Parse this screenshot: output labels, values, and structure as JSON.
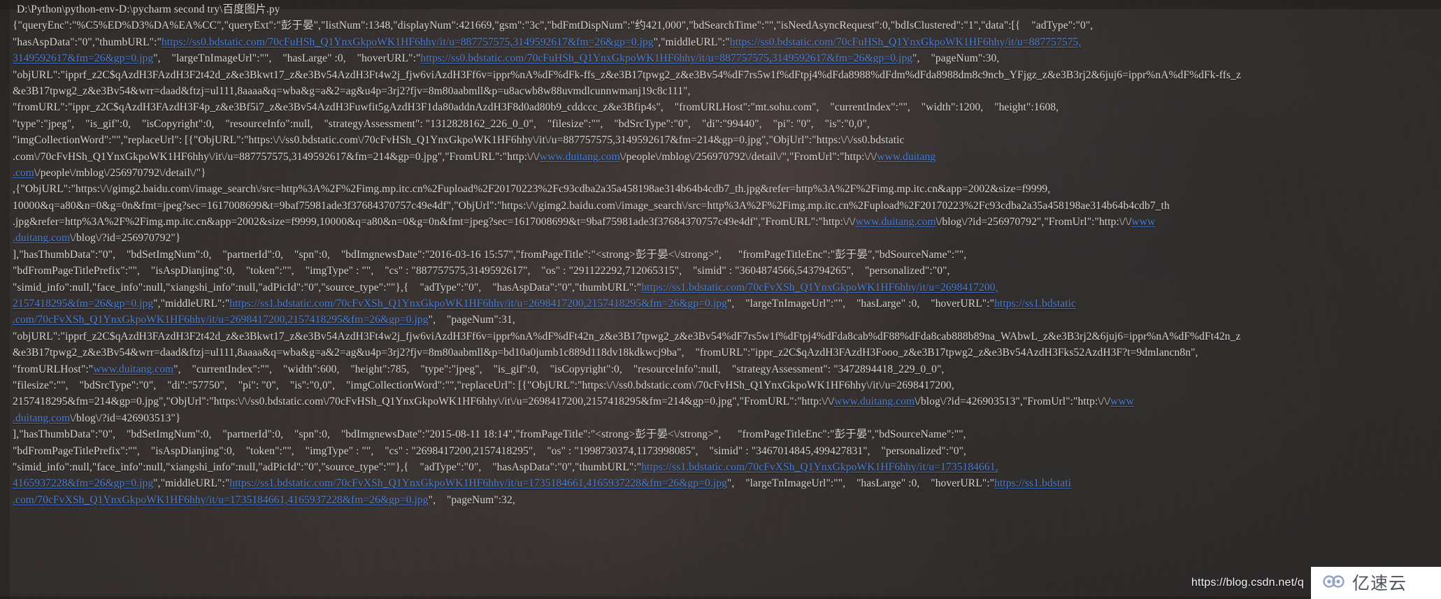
{
  "window": {
    "kind": "ide-run-console",
    "overlay_color": "#2a2828",
    "text_color": "#d8d5d0",
    "link_color": "#4b7fd4"
  },
  "console": {
    "lines": [
      {
        "indent": "first",
        "segments": [
          {
            "t": "D:\\Python\\python-env-D:\\pycharm second try\\百度图片.py",
            "link": false
          }
        ]
      },
      {
        "indent": "normal",
        "segments": [
          {
            "t": "{\"queryEnc\":\"%C5%ED%D3%DA%EA%CC\",\"queryExt\":\"彭于晏\",\"listNum\":1348,\"displayNum\":421669,\"gsm\":\"3c\",\"bdFmtDispNum\":\"约421,000\",\"bdSearchTime\":\"\",\"isNeedAsyncRequest\":0,\"bdIsClustered\":\"1\",\"data\":[{    \"adType\":\"0\",",
            "link": false
          }
        ]
      },
      {
        "indent": "normal",
        "segments": [
          {
            "t": "\"hasAspData\":\"0\",\"thumbURL\":\"",
            "link": false
          },
          {
            "t": "https://ss0.bdstatic.com/70cFuHSh_Q1YnxGkpoWK1HF6hhy/it/u=887757575,3149592617&fm=26&gp=0.jpg",
            "link": true
          },
          {
            "t": "\",\"middleURL\":\"",
            "link": false
          },
          {
            "t": "https://ss0.bdstatic.com/70cFuHSh_Q1YnxGkpoWK1HF6hhy/it/u=887757575,",
            "link": true
          }
        ]
      },
      {
        "indent": "normal",
        "segments": [
          {
            "t": "3149592617&fm=26&gp=0.jpg",
            "link": true
          },
          {
            "t": "\",    \"largeTnImageUrl\":\"\",    \"hasLarge\" :0,    \"hoverURL\":\"",
            "link": false
          },
          {
            "t": "https://ss0.bdstatic.com/70cFuHSh_Q1YnxGkpoWK1HF6hhy/it/u=887757575,3149592617&fm=26&gp=0.jpg",
            "link": true
          },
          {
            "t": "\",    \"pageNum\":30,",
            "link": false
          }
        ]
      },
      {
        "indent": "normal",
        "segments": [
          {
            "t": "\"objURL\":\"ipprf_z2C$qAzdH3FAzdH3F2t42d_z&e3Bkwt17_z&e3Bv54AzdH3Ft4w2j_fjw6viAzdH3Ff6v=ippr%nA%dF%dFk-ffs_z&e3B17tpwg2_z&e3Bv54%dF7rs5w1f%dFtpj4%dFda8988%dFdm%dFda8988dm8c9ncb_YFjgz_z&e3B3rj2&6juj6=ippr%nA%dF%dFk-ffs_z",
            "link": false
          }
        ]
      },
      {
        "indent": "normal",
        "segments": [
          {
            "t": "&e3B17tpwg2_z&e3Bv54&wrr=daad&ftzj=ul111,8aaaa&q=wba&g=a&2=ag&u4p=3rj2?fjv=8m80aabmll&p=u8acwb8w88uvmdlcunnwmanj19c8c111\",",
            "link": false
          }
        ]
      },
      {
        "indent": "normal",
        "segments": [
          {
            "t": "\"fromURL\":\"ippr_z2C$qAzdH3FAzdH3F4p_z&e3Bf5i7_z&e3Bv54AzdH3Fuwfit5gAzdH3F1da80addnAzdH3F8d0ad80b9_cddccc_z&e3Bfip4s\",    \"fromURLHost\":\"mt.sohu.com\",    \"currentIndex\":\"\",    \"width\":1200,    \"height\":1608,",
            "link": false
          }
        ]
      },
      {
        "indent": "normal",
        "segments": [
          {
            "t": "\"type\":\"jpeg\",    \"is_gif\":0,    \"isCopyright\":0,    \"resourceInfo\":null,    \"strategyAssessment\": \"1312828162_226_0_0\",    \"filesize\":\"\",    \"bdSrcType\":\"0\",    \"di\":\"99440\",    \"pi\": \"0\",    \"is\":\"0,0\",",
            "link": false
          }
        ]
      },
      {
        "indent": "normal",
        "segments": [
          {
            "t": "\"imgCollectionWord\":\"\",\"replaceUrl\": [{\"ObjURL\":\"https:\\/\\/ss0.bdstatic.com\\/70cFvHSh_Q1YnxGkpoWK1HF6hhy\\/it\\/u=887757575,3149592617&fm=214&gp=0.jpg\",\"ObjUrl\":\"https:\\/\\/ss0.bdstatic",
            "link": false
          }
        ]
      },
      {
        "indent": "normal",
        "segments": [
          {
            "t": ".com\\/70cFvHSh_Q1YnxGkpoWK1HF6hhy\\/it\\/u=887757575,3149592617&fm=214&gp=0.jpg\",\"FromURL\":\"http:\\/\\/",
            "link": false
          },
          {
            "t": "www.duitang.com",
            "link": true
          },
          {
            "t": "\\/people\\/mblog\\/256970792\\/detail\\/\",\"FromUrl\":\"http:\\/\\/",
            "link": false
          },
          {
            "t": "www.duitang",
            "link": true
          }
        ]
      },
      {
        "indent": "normal",
        "segments": [
          {
            "t": ".com",
            "link": true
          },
          {
            "t": "\\/people\\/mblog\\/256970792\\/detail\\/\"}",
            "link": false
          }
        ]
      },
      {
        "indent": "normal",
        "segments": [
          {
            "t": ",{\"ObjURL\":\"https:\\/\\/gimg2.baidu.com\\/image_search\\/src=http%3A%2F%2Fimg.mp.itc.cn%2Fupload%2F20170223%2Fc93cdba2a35a458198ae314b64b4cdb7_th.jpg&refer=http%3A%2F%2Fimg.mp.itc.cn&app=2002&size=f9999,",
            "link": false
          }
        ]
      },
      {
        "indent": "normal",
        "segments": [
          {
            "t": "10000&q=a80&n=0&g=0n&fmt=jpeg?sec=1617008699&t=9baf75981ade3f37684370757c49e4df\",\"ObjUrl\":\"https:\\/\\/gimg2.baidu.com\\/image_search\\/src=http%3A%2F%2Fimg.mp.itc.cn%2Fupload%2F20170223%2Fc93cdba2a35a458198ae314b64b4cdb7_th",
            "link": false
          }
        ]
      },
      {
        "indent": "normal",
        "segments": [
          {
            "t": ".jpg&refer=http%3A%2F%2Fimg.mp.itc.cn&app=2002&size=f9999,10000&q=a80&n=0&g=0n&fmt=jpeg?sec=1617008699&t=9baf75981ade3f37684370757c49e4df\",\"FromURL\":\"http:\\/\\/",
            "link": false
          },
          {
            "t": "www.duitang.com",
            "link": true
          },
          {
            "t": "\\/blog\\/?id=256970792\",\"FromUrl\":\"http:\\/\\/",
            "link": false
          },
          {
            "t": "www",
            "link": true
          }
        ]
      },
      {
        "indent": "normal",
        "segments": [
          {
            "t": ".duitang.com",
            "link": true
          },
          {
            "t": "\\/blog\\/?id=256970792\"}",
            "link": false
          }
        ]
      },
      {
        "indent": "normal",
        "segments": [
          {
            "t": "],\"hasThumbData\":\"0\",    \"bdSetImgNum\":0,    \"partnerId\":0,    \"spn\":0,    \"bdImgnewsDate\":\"2016-03-16 15:57\",\"fromPageTitle\":\"<strong>彭于晏<\\/strong>\",      \"fromPageTitleEnc\":\"彭于晏\",\"bdSourceName\":\"\",",
            "link": false
          }
        ]
      },
      {
        "indent": "normal",
        "segments": [
          {
            "t": "\"bdFromPageTitlePrefix\":\"\",    \"isAspDianjing\":0,    \"token\":\"\",    \"imgType\" : \"\",    \"cs\" : \"887757575,3149592617\",    \"os\" : \"291122292,712065315\",    \"simid\" : \"3604874566,543794265\",    \"personalized\":\"0\",",
            "link": false
          }
        ]
      },
      {
        "indent": "normal",
        "segments": [
          {
            "t": "\"simid_info\":null,\"face_info\":null,\"xiangshi_info\":null,\"adPicId\":\"0\",\"source_type\":\"\"},{    \"adType\":\"0\",    \"hasAspData\":\"0\",\"thumbURL\":\"",
            "link": false
          },
          {
            "t": "https://ss1.bdstatic.com/70cFvXSh_Q1YnxGkpoWK1HF6hhy/it/u=2698417200,",
            "link": true
          }
        ]
      },
      {
        "indent": "normal",
        "segments": [
          {
            "t": "2157418295&fm=26&gp=0.jpg",
            "link": true
          },
          {
            "t": "\",\"middleURL\":\"",
            "link": false
          },
          {
            "t": "https://ss1.bdstatic.com/70cFvXSh_Q1YnxGkpoWK1HF6hhy/it/u=2698417200,2157418295&fm=26&gp=0.jpg",
            "link": true
          },
          {
            "t": "\",    \"largeTnImageUrl\":\"\",    \"hasLarge\" :0,    \"hoverURL\":\"",
            "link": false
          },
          {
            "t": "https://ss1.bdstatic",
            "link": true
          }
        ]
      },
      {
        "indent": "normal",
        "segments": [
          {
            "t": ".com/70cFvXSh_Q1YnxGkpoWK1HF6hhy/it/u=2698417200,2157418295&fm=26&gp=0.jpg",
            "link": true
          },
          {
            "t": "\",    \"pageNum\":31,",
            "link": false
          }
        ]
      },
      {
        "indent": "normal",
        "segments": [
          {
            "t": "\"objURL\":\"ipprf_z2C$qAzdH3FAzdH3F2t42d_z&e3Bkwt17_z&e3Bv54AzdH3Ft4w2j_fjw6viAzdH3Ff6v=ippr%nA%dF%dFt42n_z&e3B17tpwg2_z&e3Bv54%dF7rs5w1f%dFtpj4%dFda8cab%dF88%dFda8cab888b89na_WAbwL_z&e3B3rj2&6juj6=ippr%nA%dF%dFt42n_z",
            "link": false
          }
        ]
      },
      {
        "indent": "normal",
        "segments": [
          {
            "t": "&e3B17tpwg2_z&e3Bv54&wrr=daad&ftzj=ul111,8aaaa&q=wba&g=a&2=ag&u4p=3rj2?fjv=8m80aabmll&p=bd10a0jumb1c889d118dv18kdkwcj9ba\",    \"fromURL\":\"ippr_z2C$qAzdH3FAzdH3Fooo_z&e3B17tpwg2_z&e3Bv54AzdH3Fks52AzdH3F?t=9dmlancn8n\",",
            "link": false
          }
        ]
      },
      {
        "indent": "normal",
        "segments": [
          {
            "t": "\"fromURLHost\":\"",
            "link": false
          },
          {
            "t": "www.duitang.com",
            "link": true
          },
          {
            "t": "\",    \"currentIndex\":\"\",    \"width\":600,    \"height\":785,    \"type\":\"jpeg\",    \"is_gif\":0,    \"isCopyright\":0,    \"resourceInfo\":null,    \"strategyAssessment\": \"3472894418_229_0_0\",",
            "link": false
          }
        ]
      },
      {
        "indent": "normal",
        "segments": [
          {
            "t": "\"filesize\":\"\",    \"bdSrcType\":\"0\",    \"di\":\"57750\",    \"pi\": \"0\",    \"is\":\"0,0\",    \"imgCollectionWord\":\"\",\"replaceUrl\": [{\"ObjURL\":\"https:\\/\\/ss0.bdstatic.com\\/70cFvHSh_Q1YnxGkpoWK1HF6hhy\\/it\\/u=2698417200,",
            "link": false
          }
        ]
      },
      {
        "indent": "normal",
        "segments": [
          {
            "t": "2157418295&fm=214&gp=0.jpg\",\"ObjUrl\":\"https:\\/\\/ss0.bdstatic.com\\/70cFvHSh_Q1YnxGkpoWK1HF6hhy\\/it\\/u=2698417200,2157418295&fm=214&gp=0.jpg\",\"FromURL\":\"http:\\/\\/",
            "link": false
          },
          {
            "t": "www.duitang.com",
            "link": true
          },
          {
            "t": "\\/blog\\/?id=426903513\",\"FromUrl\":\"http:\\/\\/",
            "link": false
          },
          {
            "t": "www",
            "link": true
          }
        ]
      },
      {
        "indent": "normal",
        "segments": [
          {
            "t": ".duitang.com",
            "link": true
          },
          {
            "t": "\\/blog\\/?id=426903513\"}",
            "link": false
          }
        ]
      },
      {
        "indent": "normal",
        "segments": [
          {
            "t": "],\"hasThumbData\":\"0\",    \"bdSetImgNum\":0,    \"partnerId\":0,    \"spn\":0,    \"bdImgnewsDate\":\"2015-08-11 18:14\",\"fromPageTitle\":\"<strong>彭于晏<\\/strong>\",      \"fromPageTitleEnc\":\"彭于晏\",\"bdSourceName\":\"\",",
            "link": false
          }
        ]
      },
      {
        "indent": "normal",
        "segments": [
          {
            "t": "\"bdFromPageTitlePrefix\":\"\",    \"isAspDianjing\":0,    \"token\":\"\",    \"imgType\" : \"\",    \"cs\" : \"2698417200,2157418295\",    \"os\" : \"1998730374,1173998085\",    \"simid\" : \"3467014845,499427831\",    \"personalized\":\"0\",",
            "link": false
          }
        ]
      },
      {
        "indent": "normal",
        "segments": [
          {
            "t": "\"simid_info\":null,\"face_info\":null,\"xiangshi_info\":null,\"adPicId\":\"0\",\"source_type\":\"\"},{    \"adType\":\"0\",    \"hasAspData\":\"0\",\"thumbURL\":\"",
            "link": false
          },
          {
            "t": "https://ss1.bdstatic.com/70cFvXSh_Q1YnxGkpoWK1HF6hhy/it/u=1735184661,",
            "link": true
          }
        ]
      },
      {
        "indent": "normal",
        "segments": [
          {
            "t": "4165937228&fm=26&gp=0.jpg",
            "link": true
          },
          {
            "t": "\",\"middleURL\":\"",
            "link": false
          },
          {
            "t": "https://ss1.bdstatic.com/70cFvXSh_Q1YnxGkpoWK1HF6hhy/it/u=1735184661,4165937228&fm=26&gp=0.jpg",
            "link": true
          },
          {
            "t": "\",    \"largeTnImageUrl\":\"\",    \"hasLarge\" :0,    \"hoverURL\":\"",
            "link": false
          },
          {
            "t": "https://ss1.bdstati",
            "link": true
          }
        ]
      },
      {
        "indent": "normal",
        "segments": [
          {
            "t": ".com/70cFvXSh_Q1YnxGkpoWK1HF6hhy/it/u=1735184661,4165937228&fm=26&gp=0.jpg",
            "link": true
          },
          {
            "t": "\",    \"pageNum\":32,",
            "link": false
          }
        ]
      }
    ]
  },
  "watermarks": {
    "csdn_url": "https://blog.csdn.net/q",
    "brand_name": "亿速云",
    "brand_logo_icon": "cloud-infinity-logo-icon"
  }
}
